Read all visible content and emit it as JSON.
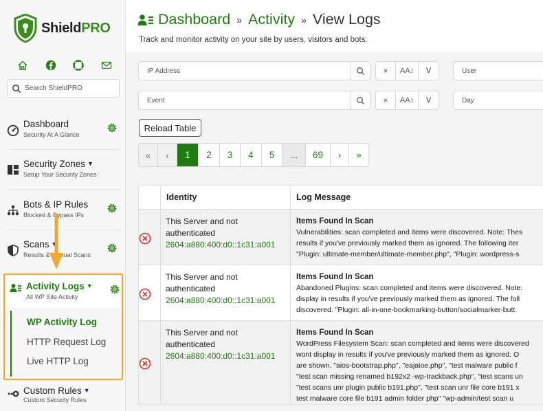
{
  "brand": {
    "name_part1": "Shield",
    "name_part2": "PRO",
    "accent": "#1f7a10",
    "highlight": "#f0a830"
  },
  "sidebar": {
    "quick_icons": [
      "home-icon",
      "facebook-icon",
      "help-lifebuoy-icon",
      "mail-icon"
    ],
    "search_placeholder": "Search ShieldPRO",
    "items": [
      {
        "title": "Dashboard",
        "subtitle": "Security At A Glance"
      },
      {
        "title": "Security Zones",
        "subtitle": "Setup Your Security Zones"
      },
      {
        "title": "Bots & IP Rules",
        "subtitle": "Blocked & Bypass IPs"
      },
      {
        "title": "Scans",
        "subtitle": "Results & Manual Scans"
      },
      {
        "title": "Activity Logs",
        "subtitle": "All WP Site Activity"
      },
      {
        "title": "Custom Rules",
        "subtitle": "Custom Security Rules"
      }
    ],
    "subitems": [
      "WP Activity Log",
      "HTTP Request Log",
      "Live HTTP Log"
    ]
  },
  "header": {
    "crumbs": [
      "Dashboard",
      "Activity",
      "View Logs"
    ],
    "separator": "»",
    "lead": "Track and monitor activity on your site by users, visitors and bots."
  },
  "filters": {
    "ip": "IP Address",
    "user": "User",
    "event": "Event",
    "day": "Day",
    "clear": "×",
    "case": "AA↕",
    "toggle": "V"
  },
  "reload_label": "Reload Table",
  "pager": [
    "«",
    "‹",
    "1",
    "2",
    "3",
    "4",
    "5",
    "...",
    "69",
    "›",
    "»"
  ],
  "table": {
    "columns": [
      "",
      "Identity",
      "Log Message"
    ],
    "rows": [
      {
        "identity_line1": "This Server and not",
        "identity_line2": "authenticated",
        "ip": "2604:a880:400:d0::1c31:a001",
        "title": "Items Found In Scan",
        "lines": [
          "Vulnerabilities: scan completed and items were discovered. Note: Thes",
          "results if you've previously marked them as ignored. The following iter",
          "\"Plugin: ultimate-member/ultimate-member.php\", \"Plugin: wordpress-s"
        ]
      },
      {
        "identity_line1": "This Server and not",
        "identity_line2": "authenticated",
        "ip": "2604:a880:400:d0::1c31:a001",
        "title": "Items Found In Scan",
        "lines": [
          "Abandoned Plugins: scan completed and items were discovered. Note:",
          "display in results if you've previously marked them as ignored. The foll",
          "discovered. \"Plugin: all-in-one-bookmarking-button/socialmarker-butt"
        ]
      },
      {
        "identity_line1": "This Server and not",
        "identity_line2": "authenticated",
        "ip": "2604:a880:400:d0::1c31:a001",
        "title": "Items Found In Scan",
        "lines": [
          "WordPress Filesystem Scan: scan completed and items were discovered",
          "wont display in results if you've previously marked them as ignored. O",
          "are shown. \"aios-bootstrap.php\", \"eajaioe.php\", \"test malware public f",
          "\"test scan missing renamed b192x2 -wp-trackback.php\", \"test scans un",
          "\"test scans unr plugin public b191.php\", \"test scan unr file core b191 x",
          "test malware core file b191 admin folder php\" \"wp-admin/test scan u"
        ]
      }
    ]
  }
}
